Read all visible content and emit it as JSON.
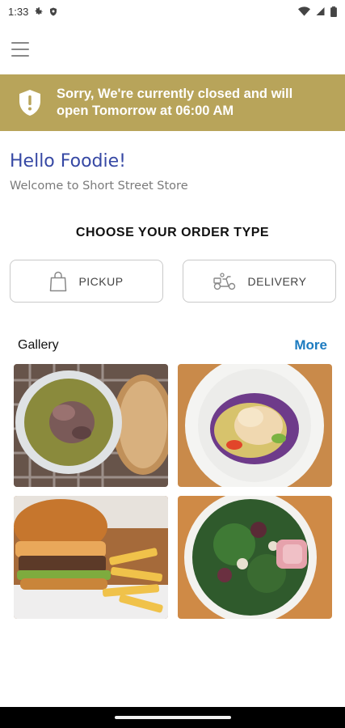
{
  "status_bar": {
    "time": "1:33"
  },
  "banner": {
    "message": "Sorry, We're currently closed and will open Tomorrow at 06:00 AM",
    "color": "#b8a45a"
  },
  "greeting": {
    "title": "Hello Foodie!",
    "subtitle": "Welcome to Short Street Store"
  },
  "order": {
    "title": "CHOOSE YOUR ORDER TYPE",
    "pickup_label": "PICKUP",
    "delivery_label": "DELIVERY"
  },
  "gallery": {
    "title": "Gallery",
    "more_label": "More",
    "items": [
      "soup-with-bread",
      "salad-with-fish",
      "burger-with-fries",
      "green-salad-bowl"
    ]
  },
  "colors": {
    "accent": "#3648a4",
    "link": "#1c7bc0"
  }
}
